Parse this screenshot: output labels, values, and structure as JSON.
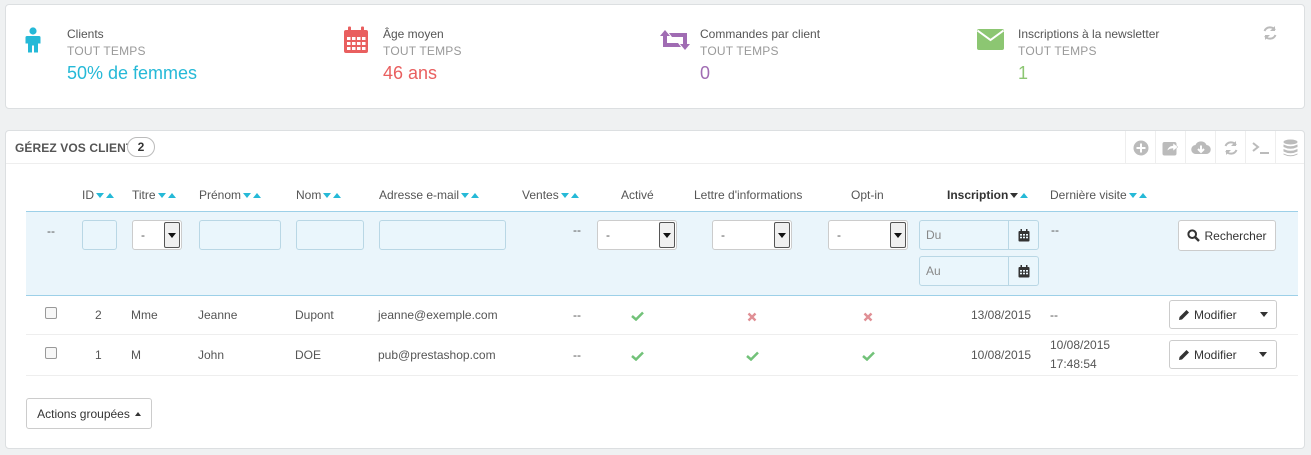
{
  "kpis": [
    {
      "title": "Clients",
      "subtitle": "TOUT TEMPS",
      "value": "50% de femmes",
      "color": "#25b9d7",
      "icon": "user-icon"
    },
    {
      "title": "Âge moyen",
      "subtitle": "TOUT TEMPS",
      "value": "46 ans",
      "color": "#e95f5f",
      "icon": "calendar-icon"
    },
    {
      "title": "Commandes par client",
      "subtitle": "TOUT TEMPS",
      "value": "0",
      "color": "#a06cb3",
      "icon": "retweet-icon"
    },
    {
      "title": "Inscriptions à la newsletter",
      "subtitle": "TOUT TEMPS",
      "value": "1",
      "color": "#8cc672",
      "icon": "envelope-icon"
    }
  ],
  "panel": {
    "title": "GÉREZ VOS CLIENTS",
    "count": "2"
  },
  "toolbar": [
    "add-icon",
    "export-icon",
    "import-icon",
    "refresh-icon",
    "sql-icon",
    "database-icon"
  ],
  "columns": {
    "id": "ID",
    "title": "Titre",
    "firstname": "Prénom",
    "lastname": "Nom",
    "email": "Adresse e-mail",
    "sales": "Ventes",
    "active": "Activé",
    "newsletter": "Lettre d'informations",
    "optin": "Opt-in",
    "registration": "Inscription",
    "last_visit": "Dernière visite"
  },
  "filters": {
    "dash": "--",
    "title_select": "-",
    "active_select": "-",
    "newsletter_select": "-",
    "optin_select": "-",
    "date_from_placeholder": "Du",
    "date_to_placeholder": "Au",
    "sales_dash": "--",
    "last_visit_dash": "--",
    "search_label": "Rechercher"
  },
  "rows": [
    {
      "id": "2",
      "title": "Mme",
      "firstname": "Jeanne",
      "lastname": "Dupont",
      "email": "jeanne@exemple.com",
      "sales": "--",
      "active": true,
      "newsletter": false,
      "optin": false,
      "registration": "13/08/2015",
      "last_visit": "--",
      "action": "Modifier"
    },
    {
      "id": "1",
      "title": "M",
      "firstname": "John",
      "lastname": "DOE",
      "email": "pub@prestashop.com",
      "sales": "--",
      "active": true,
      "newsletter": true,
      "optin": true,
      "registration": "10/08/2015",
      "last_visit": "10/08/2015",
      "last_visit_time": "17:48:54",
      "action": "Modifier"
    }
  ],
  "bulk_actions": "Actions groupées",
  "colors": {
    "accent": "#25b9d7",
    "check": "#72c279",
    "cross": "#e08f95"
  }
}
